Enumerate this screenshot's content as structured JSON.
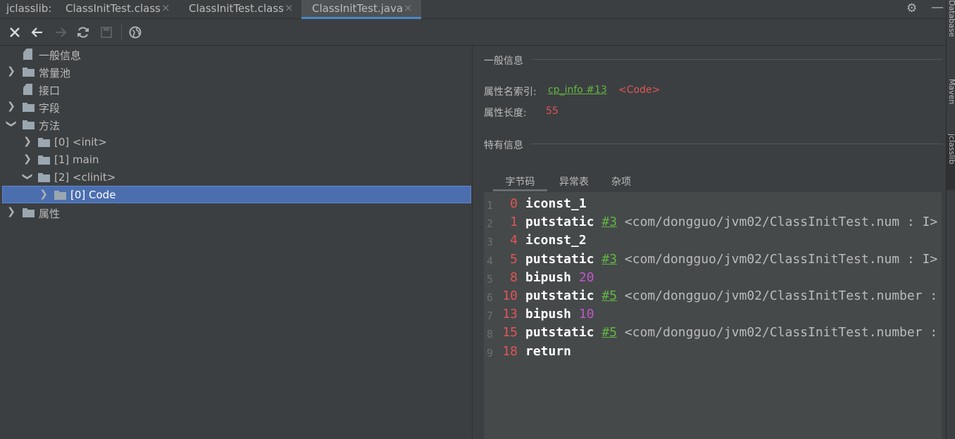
{
  "app_label": "jclasslib:",
  "tabs": [
    {
      "label": "ClassInitTest.class"
    },
    {
      "label": "ClassInitTest.class"
    },
    {
      "label": "ClassInitTest.java"
    }
  ],
  "tab_close_glyph": "×",
  "tree": [
    {
      "label": "一般信息"
    },
    {
      "label": "常量池"
    },
    {
      "label": "接口"
    },
    {
      "label": "字段"
    },
    {
      "label": "方法"
    },
    {
      "label": "[0] <init>"
    },
    {
      "label": "[1] main"
    },
    {
      "label": "[2] <clinit>"
    },
    {
      "label": "[0] Code"
    },
    {
      "label": "属性"
    }
  ],
  "panel": {
    "general_title": "一般信息",
    "attr_name_label": "属性名索引:",
    "attr_name_link": "cp_info #13",
    "attr_name_value": "<Code>",
    "attr_len_label": "属性长度:",
    "attr_len_value": "55",
    "specific_title": "特有信息",
    "subtabs": [
      {
        "label": "字节码"
      },
      {
        "label": "异常表"
      },
      {
        "label": "杂项"
      }
    ]
  },
  "bytecode": [
    {
      "ln": "1",
      "offset": "0",
      "op": "iconst_1",
      "ref": "",
      "num": "",
      "desc": ""
    },
    {
      "ln": "2",
      "offset": "1",
      "op": "putstatic",
      "ref": "#3",
      "num": "",
      "desc": "<com/dongguo/jvm02/ClassInitTest.num : I>"
    },
    {
      "ln": "3",
      "offset": "4",
      "op": "iconst_2",
      "ref": "",
      "num": "",
      "desc": ""
    },
    {
      "ln": "4",
      "offset": "5",
      "op": "putstatic",
      "ref": "#3",
      "num": "",
      "desc": "<com/dongguo/jvm02/ClassInitTest.num : I>"
    },
    {
      "ln": "5",
      "offset": "8",
      "op": "bipush",
      "ref": "",
      "num": "20",
      "desc": ""
    },
    {
      "ln": "6",
      "offset": "10",
      "op": "putstatic",
      "ref": "#5",
      "num": "",
      "desc": "<com/dongguo/jvm02/ClassInitTest.number :"
    },
    {
      "ln": "7",
      "offset": "13",
      "op": "bipush",
      "ref": "",
      "num": "10",
      "desc": ""
    },
    {
      "ln": "8",
      "offset": "15",
      "op": "putstatic",
      "ref": "#5",
      "num": "",
      "desc": "<com/dongguo/jvm02/ClassInitTest.number :"
    },
    {
      "ln": "9",
      "offset": "18",
      "op": "return",
      "ref": "",
      "num": "",
      "desc": ""
    }
  ],
  "right_strip": [
    {
      "label": "Database"
    },
    {
      "label": "Maven"
    },
    {
      "label": "jclasslib"
    }
  ]
}
